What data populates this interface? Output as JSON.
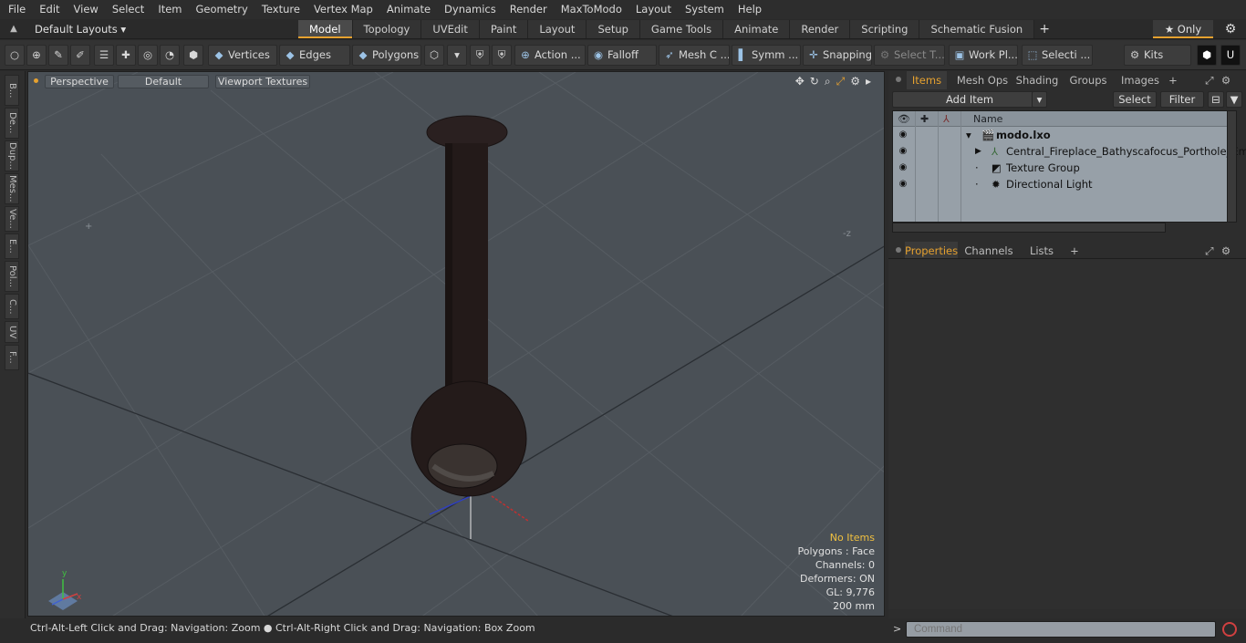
{
  "menu": [
    "File",
    "Edit",
    "View",
    "Select",
    "Item",
    "Geometry",
    "Texture",
    "Vertex Map",
    "Animate",
    "Dynamics",
    "Render",
    "MaxToModo",
    "Layout",
    "System",
    "Help"
  ],
  "layoutbar": {
    "layouts_label": "Default Layouts ▾",
    "tabs": [
      "Model",
      "Topology",
      "UVEdit",
      "Paint",
      "Layout",
      "Setup",
      "Game Tools",
      "Animate",
      "Render",
      "Scripting",
      "Schematic Fusion"
    ],
    "active_tab": "Model",
    "add": "+",
    "only_label": "★  Only"
  },
  "toolbar": {
    "vertices": "Vertices",
    "edges": "Edges",
    "polygons": "Polygons",
    "action": "Action",
    "falloff": "Falloff",
    "mesh": "Mesh C ...",
    "symm": "Symm ...",
    "snapping": "Snapping",
    "select_t": "Select T...",
    "work_pl": "Work Pl...",
    "selecti": "Selecti ...",
    "kits": "Kits",
    "more": "..."
  },
  "leftstrip": [
    "B...",
    "De...",
    "Dup...",
    "Mes...",
    "Ve...",
    "E...",
    "Pol...",
    "C...",
    "UV",
    "F..."
  ],
  "viewport": {
    "view_mode": "Perspective",
    "shading": "Default",
    "textures": "Viewport Textures",
    "hud": {
      "no_items": "No Items",
      "polygons": "Polygons : Face",
      "channels": "Channels: 0",
      "deformers": "Deformers: ON",
      "gl": "GL: 9,776",
      "scale": "200 mm"
    }
  },
  "statusbar": "Ctrl-Alt-Left Click and Drag: Navigation: Zoom ● Ctrl-Alt-Right Click and Drag: Navigation: Box Zoom",
  "items_panel": {
    "tabs": [
      "Items",
      "Mesh Ops",
      "Shading",
      "Groups",
      "Images"
    ],
    "add_tab": "+",
    "add_item": "Add Item",
    "select": "Select",
    "filter": "Filter",
    "column_name": "Name",
    "rows": [
      {
        "label": "modo.lxo"
      },
      {
        "label": "Central_Fireplace_Bathyscafocus_Porthole_Em ..."
      },
      {
        "label": "Texture Group"
      },
      {
        "label": "Directional Light"
      }
    ]
  },
  "props_panel": {
    "tabs": [
      "Properties",
      "Channels",
      "Lists"
    ],
    "add_tab": "+"
  },
  "command": {
    "placeholder": "Command"
  },
  "colors": {
    "accent": "#e6a12f",
    "viewport_bg": "#4a5056",
    "model": "#241b1a"
  }
}
